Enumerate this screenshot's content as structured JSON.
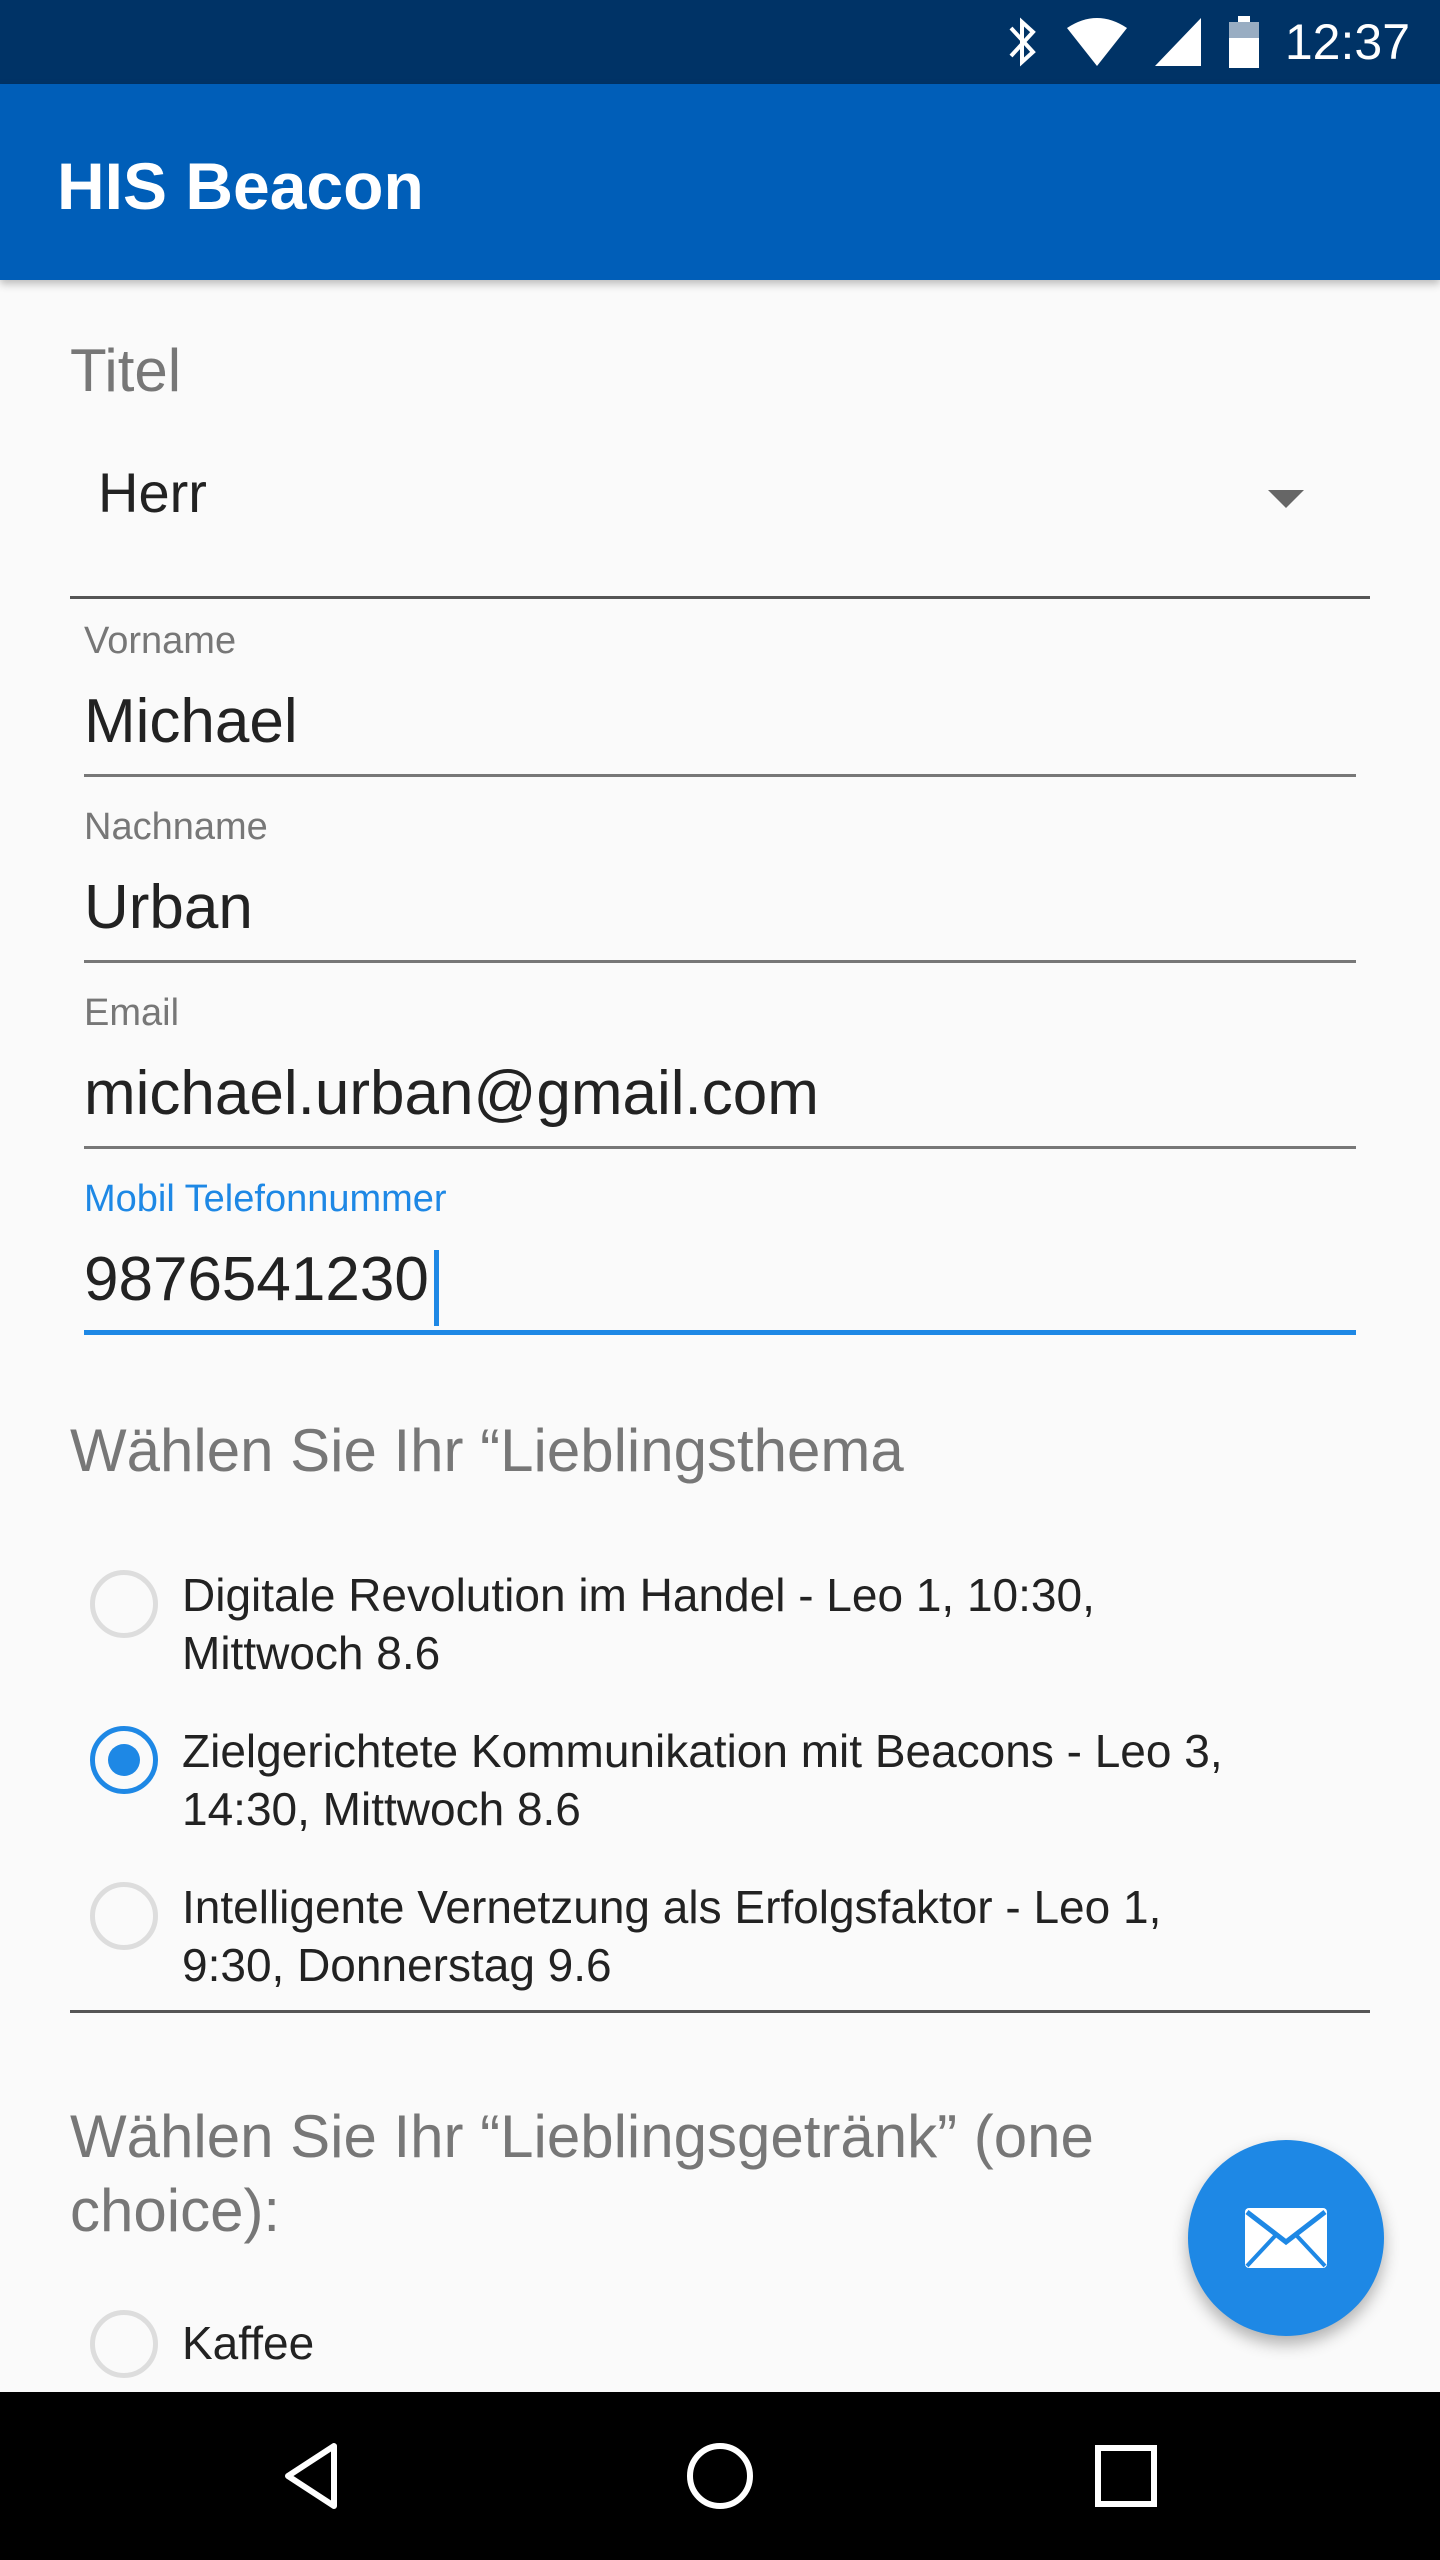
{
  "status_bar": {
    "time": "12:37",
    "icons": [
      "bluetooth-icon",
      "wifi-icon",
      "cell-signal-icon",
      "battery-icon"
    ]
  },
  "app_bar": {
    "title": "HIS Beacon"
  },
  "form": {
    "title_field": {
      "label": "Titel",
      "value": "Herr"
    },
    "first_name": {
      "label": "Vorname",
      "value": "Michael"
    },
    "last_name": {
      "label": "Nachname",
      "value": "Urban"
    },
    "email": {
      "label": "Email",
      "value": "michael.urban@gmail.com"
    },
    "mobile": {
      "label": "Mobil Telefonnummer",
      "value": "9876541230"
    }
  },
  "topic_section": {
    "title": "Wählen Sie Ihr “Lieblingsthema",
    "options": [
      {
        "line1": "Digitale Revolution im Handel - Leo 1, 10:30,",
        "line2": "Mittwoch 8.6",
        "checked": false
      },
      {
        "line1": "Zielgerichtete Kommunikation mit Beacons - Leo 3,",
        "line2": "14:30, Mittwoch 8.6",
        "checked": true
      },
      {
        "line1": "Intelligente Vernetzung als Erfolgsfaktor - Leo 1,",
        "line2": "9:30, Donnerstag 9.6",
        "checked": false
      }
    ]
  },
  "drink_section": {
    "title_line1": "Wählen Sie Ihr “Lieblingsgetränk” (one",
    "title_line2": "choice):",
    "options": [
      {
        "label": "Kaffee",
        "checked": false
      }
    ]
  },
  "fab": {
    "icon": "envelope-icon"
  },
  "nav_bar": {
    "icons": [
      "back-icon",
      "home-icon",
      "recents-icon"
    ]
  },
  "colors": {
    "status_bar": "#003366",
    "app_bar": "#005eb8",
    "accent": "#1e88e5"
  }
}
